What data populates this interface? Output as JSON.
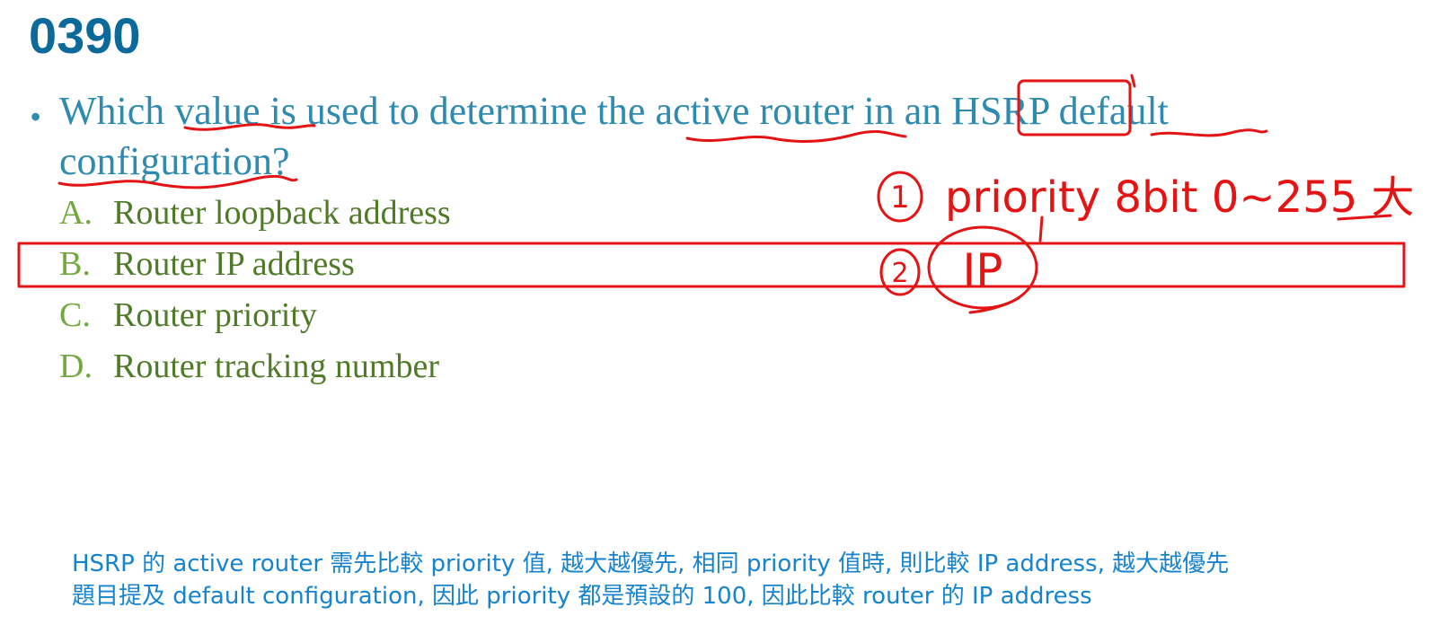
{
  "title": "0390",
  "question": {
    "bullet": "•",
    "text": "Which value is used to determine the active router in an HSRP default configuration?"
  },
  "options": [
    {
      "letter": "A.",
      "text": "Router loopback address"
    },
    {
      "letter": "B.",
      "text": "Router IP address"
    },
    {
      "letter": "C.",
      "text": "Router priority"
    },
    {
      "letter": "D.",
      "text": "Router tracking number"
    }
  ],
  "explanation": {
    "line1": "HSRP 的 active router 需先比較 priority 值, 越大越優先, 相同 priority 值時, 則比較 IP address, 越大越優先",
    "line2": "題目提及 default configuration, 因此 priority 都是預設的 100, 因此比較 router 的 IP address"
  },
  "annotations": {
    "note1_number": "1",
    "note1_text": "priority 8bit 0~255 大",
    "note2_number": "2",
    "note2_text": "IP",
    "ink_color": "#e41414"
  },
  "colors": {
    "title": "#0b6a9a",
    "question": "#2f8ab0",
    "option_letter": "#72a83e",
    "option_text": "#4f7a28",
    "explanation": "#1683cf"
  }
}
